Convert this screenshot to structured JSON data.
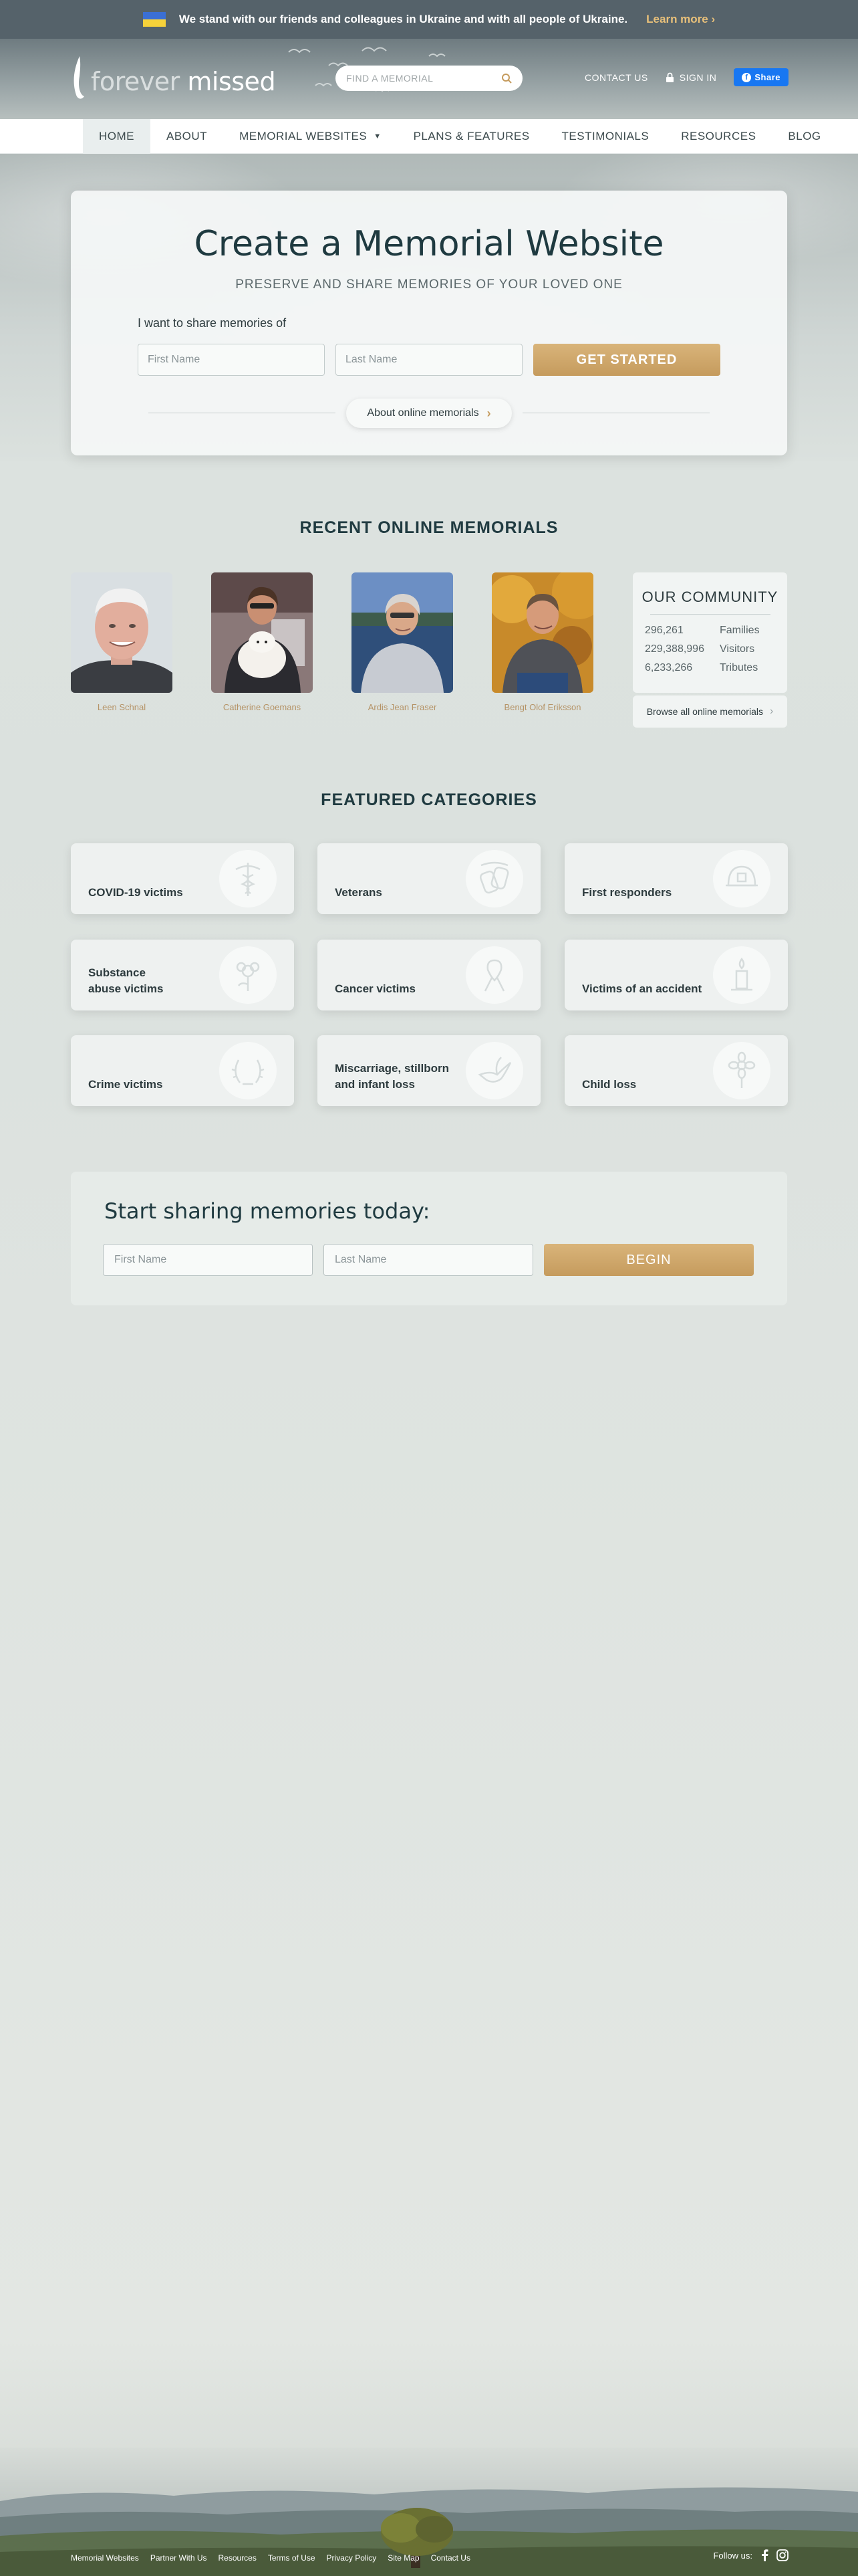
{
  "ua_banner": {
    "text": "We stand with our friends and colleagues in Ukraine and with all people of Ukraine.",
    "link": "Learn more",
    "link_arrow": "›"
  },
  "header": {
    "logo_word1": "forever",
    "logo_word2": "missed",
    "search_placeholder": "FIND A MEMORIAL",
    "contact": "CONTACT US",
    "signin": "SIGN IN",
    "share": "Share"
  },
  "nav": {
    "items": [
      "HOME",
      "ABOUT",
      "MEMORIAL WEBSITES",
      "PLANS & FEATURES",
      "TESTIMONIALS",
      "RESOURCES",
      "BLOG"
    ]
  },
  "hero": {
    "title": "Create a Memorial Website",
    "subtitle": "PRESERVE AND SHARE MEMORIES OF YOUR LOVED ONE",
    "share_label": "I want to share memories of",
    "first_name_placeholder": "First Name",
    "last_name_placeholder": "Last Name",
    "cta": "GET STARTED",
    "about_link": "About online memorials"
  },
  "recent": {
    "title": "RECENT ONLINE MEMORIALS",
    "memorials": [
      {
        "name": "Leen Schnal"
      },
      {
        "name": "Catherine Goemans"
      },
      {
        "name": "Ardis Jean Fraser"
      },
      {
        "name": "Bengt Olof Eriksson"
      }
    ],
    "community": {
      "title": "OUR COMMUNITY",
      "stats": [
        {
          "value": "296,261",
          "label": "Families"
        },
        {
          "value": "229,388,996",
          "label": "Visitors"
        },
        {
          "value": "6,233,266",
          "label": "Tributes"
        }
      ],
      "browse": "Browse all online memorials"
    }
  },
  "categories": {
    "title": "FEATURED CATEGORIES",
    "items": [
      {
        "label": "COVID-19 victims",
        "icon": "caduceus-icon"
      },
      {
        "label": "Veterans",
        "icon": "dog-tags-icon"
      },
      {
        "label": "First responders",
        "icon": "helmet-icon"
      },
      {
        "label_line1": "Substance",
        "label_line2": "abuse victims",
        "icon": "flower-icon"
      },
      {
        "label": "Cancer victims",
        "icon": "ribbon-icon"
      },
      {
        "label": "Victims of an accident",
        "icon": "candle-icon"
      },
      {
        "label": "Crime victims",
        "icon": "wreath-icon"
      },
      {
        "label_line1": "Miscarriage, stillborn",
        "label_line2": "and infant loss",
        "icon": "dove-icon"
      },
      {
        "label": "Child loss",
        "icon": "flower-bloom-icon"
      }
    ]
  },
  "start": {
    "title": "Start sharing memories today:",
    "first_name_placeholder": "First Name",
    "last_name_placeholder": "Last Name",
    "cta": "BEGIN"
  },
  "footer": {
    "links": [
      "Memorial Websites",
      "Partner With Us",
      "Resources",
      "Terms of Use",
      "Privacy Policy",
      "Site Map",
      "Contact Us"
    ],
    "follow": "Follow us:"
  },
  "colors": {
    "gold": "#c59b5d",
    "dark_teal": "#1f3a40",
    "facebook": "#1877f2",
    "ua_blue": "#3b6fd4",
    "ua_yellow": "#f7d23a"
  }
}
